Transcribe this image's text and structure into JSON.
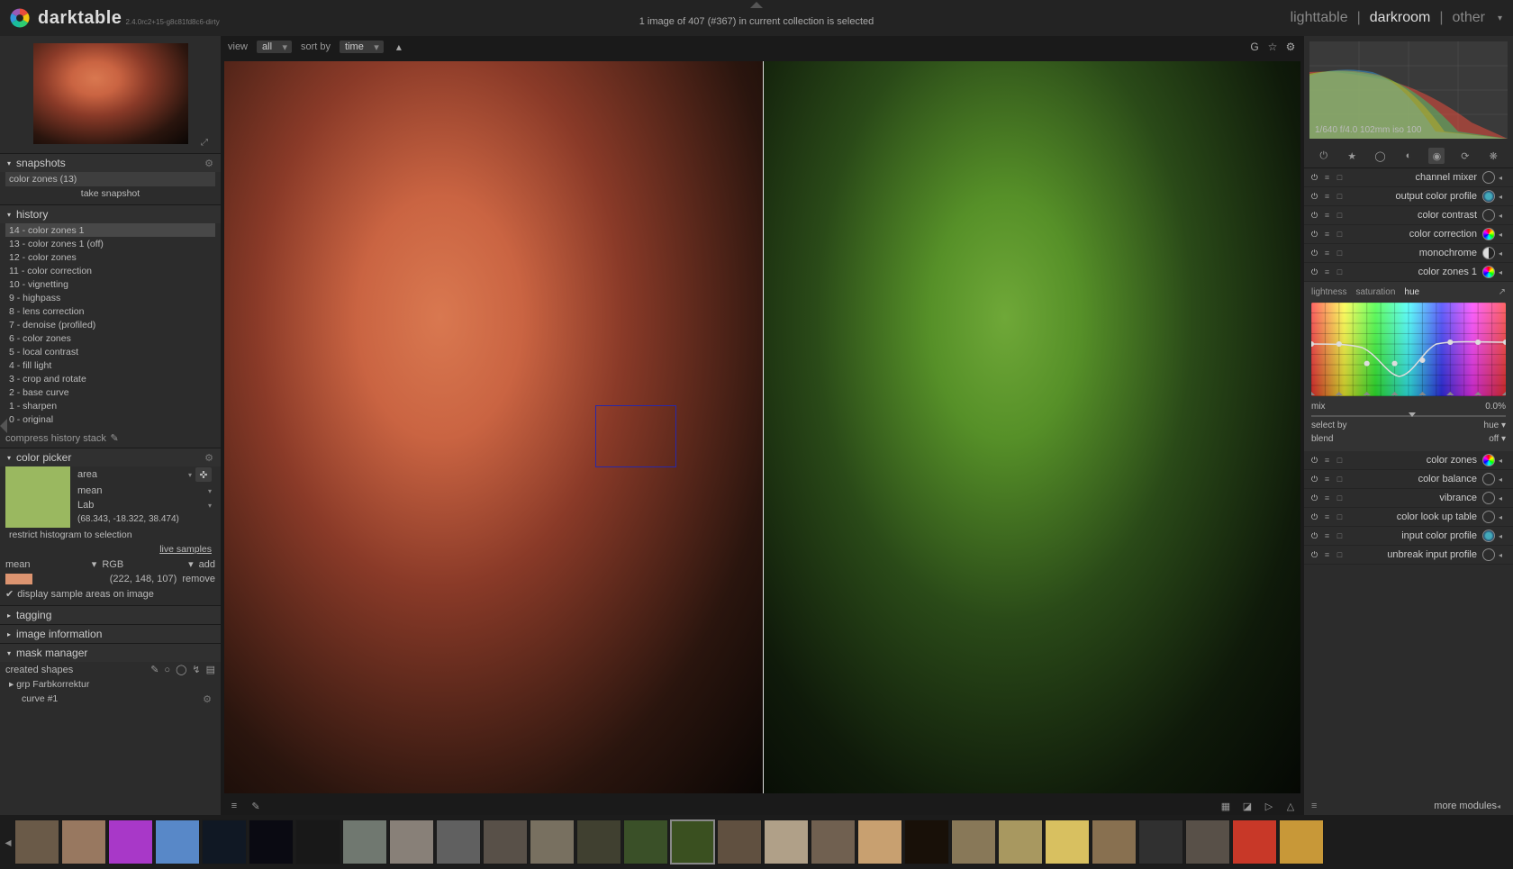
{
  "app": {
    "name": "darktable",
    "version": "2.4.0rc2+15-g8c81fd8c6-dirty"
  },
  "status": "1 image of 407 (#367) in current collection is selected",
  "views": {
    "lighttable": "lighttable",
    "darkroom": "darkroom",
    "other": "other",
    "active": "darkroom"
  },
  "toolbar": {
    "view_label": "view",
    "view_value": "all",
    "sort_label": "sort by",
    "sort_value": "time"
  },
  "left": {
    "snapshots": {
      "title": "snapshots",
      "snapshot_label": "color zones (13)",
      "take": "take snapshot"
    },
    "history": {
      "title": "history",
      "items": [
        "14 - color zones 1",
        "13 - color zones 1 (off)",
        "12 - color zones",
        "11 - color correction",
        "10 - vignetting",
        "9 - highpass",
        "8 - lens correction",
        "7 - denoise (profiled)",
        "6 - color zones",
        "5 - local contrast",
        "4 - fill light",
        "3 - crop and rotate",
        "2 - base curve",
        "1 - sharpen",
        "0 - original"
      ],
      "compress": "compress history stack"
    },
    "colorpicker": {
      "title": "color picker",
      "mode": "area",
      "stat": "mean",
      "model": "Lab",
      "lab_value": "(68.343, -18.322, 38.474)",
      "restrict": "restrict histogram to selection",
      "live_samples": "live samples",
      "row_stat": "mean",
      "row_model": "RGB",
      "add": "add",
      "rgb_value": "(222, 148, 107)",
      "remove": "remove",
      "display_check": "display sample areas on image"
    },
    "tagging": {
      "title": "tagging"
    },
    "image_info": {
      "title": "image information"
    },
    "mask_manager": {
      "title": "mask manager",
      "created": "created shapes",
      "group": "grp Farbkorrektur",
      "curve": "curve #1"
    }
  },
  "right": {
    "exif": "1/640 f/4.0 102mm iso 100",
    "modules": [
      {
        "name": "channel mixer",
        "icon": "mixer"
      },
      {
        "name": "output color profile",
        "icon": "profile-out"
      },
      {
        "name": "color contrast",
        "icon": "circle"
      },
      {
        "name": "color correction",
        "icon": "rainbow"
      },
      {
        "name": "monochrome",
        "icon": "half"
      },
      {
        "name": "color zones 1",
        "icon": "rainbow",
        "expanded": true
      },
      {
        "name": "color zones",
        "icon": "rainbow"
      },
      {
        "name": "color balance",
        "icon": "circle"
      },
      {
        "name": "vibrance",
        "icon": "circle"
      },
      {
        "name": "color look up table",
        "icon": "circle"
      },
      {
        "name": "input color profile",
        "icon": "profile-in"
      },
      {
        "name": "unbreak input profile",
        "icon": "circle"
      }
    ],
    "colorzones": {
      "tabs": {
        "l": "lightness",
        "s": "saturation",
        "h": "hue"
      },
      "mix_label": "mix",
      "mix_value": "0.0%",
      "select_label": "select by",
      "select_value": "hue",
      "blend_label": "blend",
      "blend_value": "off"
    },
    "more_modules": "more modules"
  },
  "filmstrip": {
    "count": 28,
    "selected_index": 14
  }
}
